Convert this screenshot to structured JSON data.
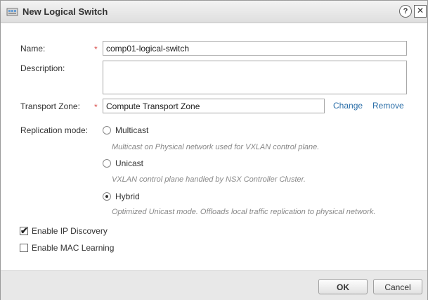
{
  "dialog": {
    "title": "New Logical Switch",
    "help_label": "?",
    "close_label": "✕"
  },
  "form": {
    "name_label": "Name:",
    "name_value": "comp01-logical-switch",
    "description_label": "Description:",
    "description_value": "",
    "transport_zone_label": "Transport Zone:",
    "transport_zone_value": "Compute Transport Zone",
    "change_link": "Change",
    "remove_link": "Remove",
    "required_marker": "*",
    "replication_label": "Replication mode:",
    "replication_selected": "Hybrid",
    "replication_options": [
      {
        "label": "Multicast",
        "description": "Multicast on Physical network used for VXLAN control plane."
      },
      {
        "label": "Unicast",
        "description": "VXLAN control plane handled by NSX Controller Cluster."
      },
      {
        "label": "Hybrid",
        "description": "Optimized Unicast mode. Offloads local traffic replication to physical network."
      }
    ],
    "enable_ip_discovery_label": "Enable IP Discovery",
    "enable_ip_discovery_checked": true,
    "enable_mac_learning_label": "Enable MAC Learning",
    "enable_mac_learning_checked": false
  },
  "footer": {
    "ok_label": "OK",
    "cancel_label": "Cancel"
  },
  "icons": {
    "title": "logical-switch-icon",
    "check": "✔"
  }
}
